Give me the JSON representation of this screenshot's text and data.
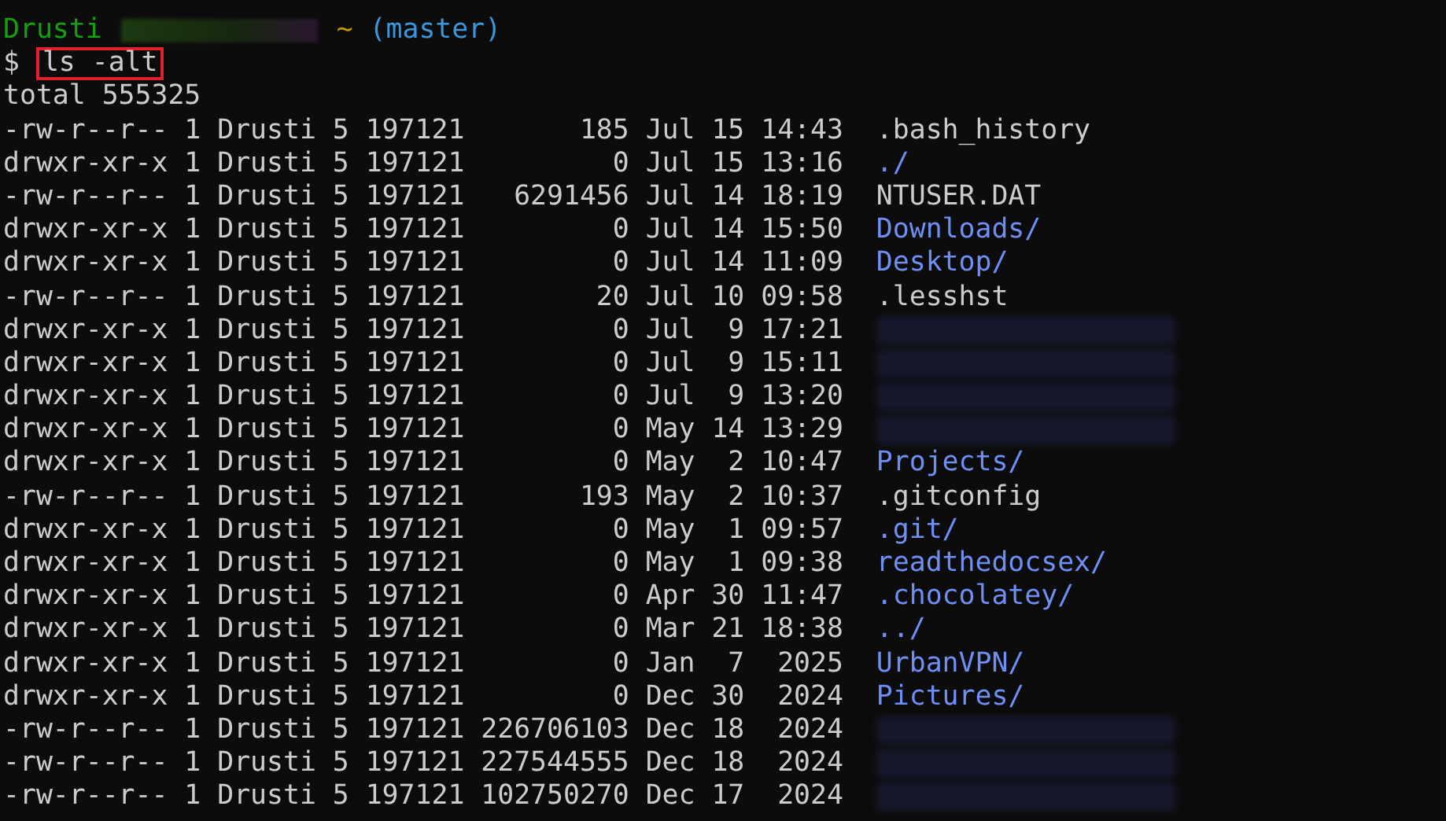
{
  "prompt": {
    "user": "Drusti",
    "path": "~",
    "branch": "(master)"
  },
  "command": {
    "symbol": "$",
    "text": "ls -alt",
    "highlighted": true
  },
  "total": "total 555325",
  "entries": [
    {
      "info": "-rw-r--r-- 1 Drusti 5 197121       185 Jul 15 14:43",
      "name": ".bash_history",
      "kind": "file"
    },
    {
      "info": "drwxr-xr-x 1 Drusti 5 197121         0 Jul 15 13:16",
      "name": "./",
      "kind": "dir"
    },
    {
      "info": "-rw-r--r-- 1 Drusti 5 197121   6291456 Jul 14 18:19",
      "name": "NTUSER.DAT",
      "kind": "file"
    },
    {
      "info": "drwxr-xr-x 1 Drusti 5 197121         0 Jul 14 15:50",
      "name": "Downloads/",
      "kind": "dir"
    },
    {
      "info": "drwxr-xr-x 1 Drusti 5 197121         0 Jul 14 11:09",
      "name": "Desktop/",
      "kind": "dir"
    },
    {
      "info": "-rw-r--r-- 1 Drusti 5 197121        20 Jul 10 09:58",
      "name": ".lesshst",
      "kind": "file"
    },
    {
      "info": "drwxr-xr-x 1 Drusti 5 197121         0 Jul  9 17:21",
      "kind": "redacted"
    },
    {
      "info": "drwxr-xr-x 1 Drusti 5 197121         0 Jul  9 15:11",
      "kind": "redacted"
    },
    {
      "info": "drwxr-xr-x 1 Drusti 5 197121         0 Jul  9 13:20",
      "kind": "redacted"
    },
    {
      "info": "drwxr-xr-x 1 Drusti 5 197121         0 May 14 13:29",
      "kind": "redacted"
    },
    {
      "info": "drwxr-xr-x 1 Drusti 5 197121         0 May  2 10:47",
      "name": "Projects/",
      "kind": "dir"
    },
    {
      "info": "-rw-r--r-- 1 Drusti 5 197121       193 May  2 10:37",
      "name": ".gitconfig",
      "kind": "file"
    },
    {
      "info": "drwxr-xr-x 1 Drusti 5 197121         0 May  1 09:57",
      "name": ".git/",
      "kind": "dir"
    },
    {
      "info": "drwxr-xr-x 1 Drusti 5 197121         0 May  1 09:38",
      "name": "readthedocsex/",
      "kind": "dir"
    },
    {
      "info": "drwxr-xr-x 1 Drusti 5 197121         0 Apr 30 11:47",
      "name": ".chocolatey/",
      "kind": "dir"
    },
    {
      "info": "drwxr-xr-x 1 Drusti 5 197121         0 Mar 21 18:38",
      "name": "../",
      "kind": "dir"
    },
    {
      "info": "drwxr-xr-x 1 Drusti 5 197121         0 Jan  7  2025",
      "name": "UrbanVPN/",
      "kind": "dir"
    },
    {
      "info": "drwxr-xr-x 1 Drusti 5 197121         0 Dec 30  2024",
      "name": "Pictures/",
      "kind": "dir"
    },
    {
      "info": "-rw-r--r-- 1 Drusti 5 197121 226706103 Dec 18  2024",
      "kind": "redacted"
    },
    {
      "info": "-rw-r--r-- 1 Drusti 5 197121 227544555 Dec 18  2024",
      "kind": "redacted"
    },
    {
      "info": "-rw-r--r-- 1 Drusti 5 197121 102750270 Dec 17  2024",
      "kind": "redacted"
    }
  ]
}
